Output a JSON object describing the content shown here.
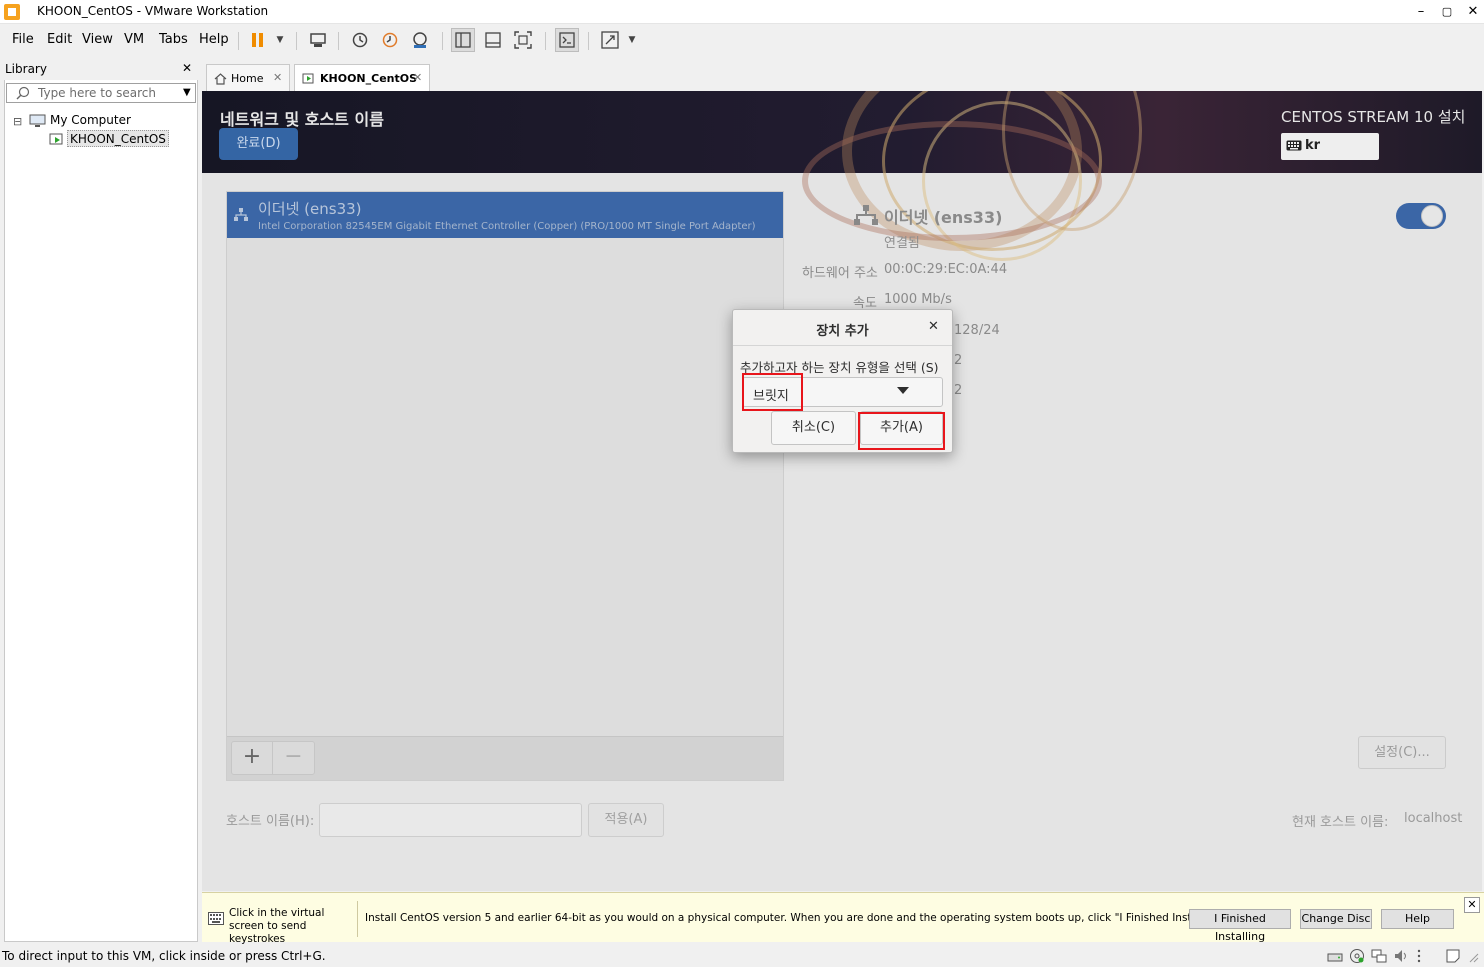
{
  "window": {
    "title": "KHOON_CentOS - VMware Workstation",
    "controls": {
      "minimize": "–",
      "maximize": "▢",
      "close": "✕"
    }
  },
  "menu": {
    "file": "File",
    "edit": "Edit",
    "view": "View",
    "vm": "VM",
    "tabs": "Tabs",
    "help": "Help"
  },
  "library": {
    "title": "Library",
    "close": "✕",
    "search_placeholder": "Type here to search",
    "tree_root": "My Computer",
    "tree_vm": "KHOON_CentOS",
    "expander": "⊟"
  },
  "tabs": [
    {
      "label": "Home",
      "close": "✕"
    },
    {
      "label": "KHOON_CentOS",
      "close": "✕"
    }
  ],
  "installer": {
    "page_title": "네트워크 및 호스트 이름",
    "done_button": "완료(D)",
    "product_title": "CENTOS STREAM 10 설치",
    "keyboard_layout": "kr",
    "device_name": "이더넷 (ens33)",
    "device_desc": "Intel Corporation 82545EM Gigabit Ethernet Controller (Copper) (PRO/1000 MT Single Port Adapter)",
    "add_button": "+",
    "remove_button": "−",
    "detail": {
      "title": "이더넷 (ens33)",
      "status": "연결됨",
      "hw_label": "하드웨어 주소",
      "hw_value": "00:0C:29:EC:0A:44",
      "speed_label": "속도",
      "speed_value": "1000 Mb/s",
      "ip_partial": "128/24",
      "gw_partial": "2",
      "dns_partial": "2"
    },
    "settings_button": "설정(C)...",
    "hostname_label": "호스트 이름(H):",
    "hostname_value": "",
    "apply_button": "적용(A)",
    "current_hostname_label": "현재 호스트 이름:",
    "current_hostname_value": "localhost"
  },
  "dialog": {
    "title": "장치 추가",
    "close": "✕",
    "prompt": "추가하고자 하는 장치 유형을 선택 (S)",
    "selected_type": "브릿지",
    "cancel_button": "취소(C)",
    "add_button": "추가(A)"
  },
  "infobar": {
    "hint": "Click in the virtual screen to send keystrokes",
    "message": "Install CentOS version 5 and earlier 64-bit as you would on a physical computer. When you are done and the operating system boots up, click \"I Finished Installing\".",
    "finished_button": "I Finished Installing",
    "change_disc_button": "Change Disc",
    "help_button": "Help",
    "close": "✕"
  },
  "statusbar": {
    "message": "To direct input to this VM, click inside or press Ctrl+G."
  },
  "colors": {
    "accent_blue": "#3465a4",
    "highlight_red": "#e8151b",
    "header_dark": "#1a1826"
  }
}
